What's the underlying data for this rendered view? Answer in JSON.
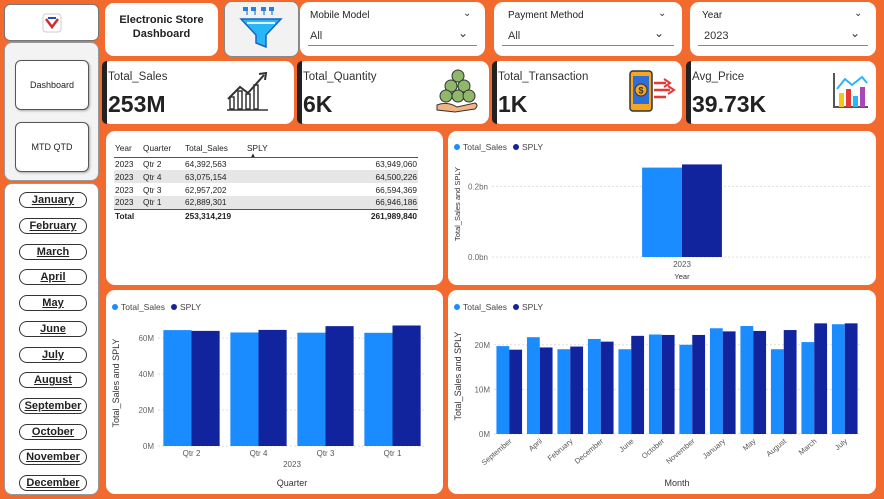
{
  "header": {
    "title_line1": "Electronic Store",
    "title_line2": "Dashboard"
  },
  "slicers": [
    {
      "label": "Mobile Model",
      "value": "All"
    },
    {
      "label": "Payment Method",
      "value": "All"
    },
    {
      "label": "Year",
      "value": "2023"
    }
  ],
  "nav": {
    "dashboard": "Dashboard",
    "mtd": "MTD QTD"
  },
  "months": [
    "January",
    "February",
    "March",
    "April",
    "May",
    "June",
    "July",
    "August",
    "September",
    "October",
    "November",
    "December"
  ],
  "kpis": [
    {
      "title": "Total_Sales",
      "value": "253M",
      "icon": "sales-chart-icon"
    },
    {
      "title": "Total_Quantity",
      "value": "6K",
      "icon": "coins-hand-icon"
    },
    {
      "title": "Total_Transaction",
      "value": "1K",
      "icon": "mobile-payment-icon"
    },
    {
      "title": "Avg_Price",
      "value": "39.73K",
      "icon": "bar-chart-icon"
    }
  ],
  "matrix": {
    "headers": [
      "Year",
      "Quarter",
      "Total_Sales",
      "SPLY"
    ],
    "rows": [
      [
        "2023",
        "Qtr 2",
        "64,392,563",
        "63,949,060"
      ],
      [
        "2023",
        "Qtr 4",
        "63,075,154",
        "64,500,226"
      ],
      [
        "2023",
        "Qtr 3",
        "62,957,202",
        "66,594,369"
      ],
      [
        "2023",
        "Qtr 1",
        "62,889,301",
        "66,946,186"
      ]
    ],
    "total": [
      "Total",
      "",
      "253,314,219",
      "261,989,840"
    ]
  },
  "colors": {
    "total_sales": "#1a8cff",
    "sply": "#12239e",
    "background": "#f26a2e"
  },
  "chart_data": [
    {
      "type": "bar",
      "categories": [
        "2023"
      ],
      "series": [
        {
          "name": "Total_Sales",
          "values": [
            0.253
          ]
        },
        {
          "name": "SPLY",
          "values": [
            0.262
          ]
        }
      ],
      "xlabel": "Year",
      "ylabel": "Total_Sales and SPLY",
      "yticks": [
        "0.0bn",
        "0.2bn"
      ],
      "ylim": [
        0,
        0.3
      ],
      "legend": "top-left"
    },
    {
      "type": "bar",
      "categories": [
        "Qtr 2",
        "Qtr 4",
        "Qtr 3",
        "Qtr 1"
      ],
      "series": [
        {
          "name": "Total_Sales",
          "values": [
            64.39,
            63.08,
            62.96,
            62.89
          ]
        },
        {
          "name": "SPLY",
          "values": [
            63.95,
            64.5,
            66.59,
            66.95
          ]
        }
      ],
      "xsublabel": "2023",
      "xlabel": "Quarter",
      "ylabel": "Total_Sales and SPLY",
      "yticks": [
        "0M",
        "20M",
        "40M",
        "60M"
      ],
      "ylim": [
        0,
        70
      ],
      "legend": "top-left"
    },
    {
      "type": "bar",
      "categories": [
        "September",
        "April",
        "February",
        "December",
        "June",
        "October",
        "November",
        "January",
        "May",
        "August",
        "March",
        "July"
      ],
      "series": [
        {
          "name": "Total_Sales",
          "values": [
            19.7,
            21.7,
            19.0,
            21.3,
            19.0,
            22.3,
            20.0,
            23.7,
            24.2,
            19.0,
            20.6,
            24.6
          ]
        },
        {
          "name": "SPLY",
          "values": [
            18.9,
            19.4,
            19.6,
            20.7,
            22.0,
            22.2,
            22.2,
            23.0,
            23.1,
            23.3,
            24.8,
            24.8
          ]
        }
      ],
      "xlabel": "Month",
      "ylabel": "Total_Sales and SPLY",
      "yticks": [
        "0M",
        "10M",
        "20M"
      ],
      "ylim": [
        0,
        26
      ],
      "legend": "top-left"
    }
  ]
}
